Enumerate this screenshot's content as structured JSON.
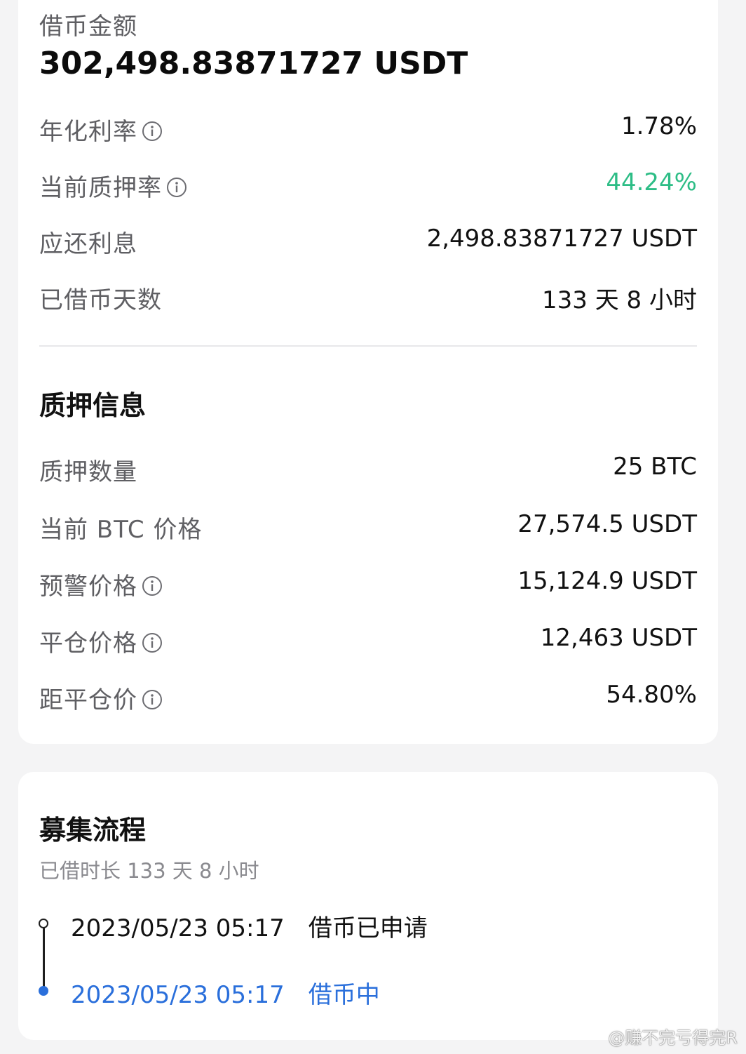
{
  "loan": {
    "amount_label": "借币金额",
    "amount_value": "302,498.83871727 USDT",
    "rows": [
      {
        "label": "年化利率",
        "value": "1.78%",
        "info": true
      },
      {
        "label": "当前质押率",
        "value": "44.24%",
        "info": true,
        "value_color": "#2dbd86"
      },
      {
        "label": "应还利息",
        "value": "2,498.83871727 USDT",
        "info": false
      },
      {
        "label": "已借币天数",
        "value": "133 天 8 小时",
        "info": false
      }
    ]
  },
  "collateral": {
    "title": "质押信息",
    "rows": [
      {
        "label": "质押数量",
        "value": "25 BTC",
        "info": false
      },
      {
        "label": "当前 BTC 价格",
        "value": "27,574.5 USDT",
        "info": false
      },
      {
        "label": "预警价格",
        "value": "15,124.9 USDT",
        "info": true
      },
      {
        "label": "平仓价格",
        "value": "12,463 USDT",
        "info": true
      },
      {
        "label": "距平仓价",
        "value": "54.80%",
        "info": true
      }
    ]
  },
  "process": {
    "title": "募集流程",
    "subtitle": "已借时长 133 天 8 小时",
    "steps": [
      {
        "time": "2023/05/23 05:17",
        "status": "借币已申请",
        "active": false
      },
      {
        "time": "2023/05/23 05:17",
        "status": "借币中",
        "active": true
      }
    ]
  },
  "watermark": "@赚不完亏得完R",
  "icons": {
    "info": "info-circle-icon"
  }
}
